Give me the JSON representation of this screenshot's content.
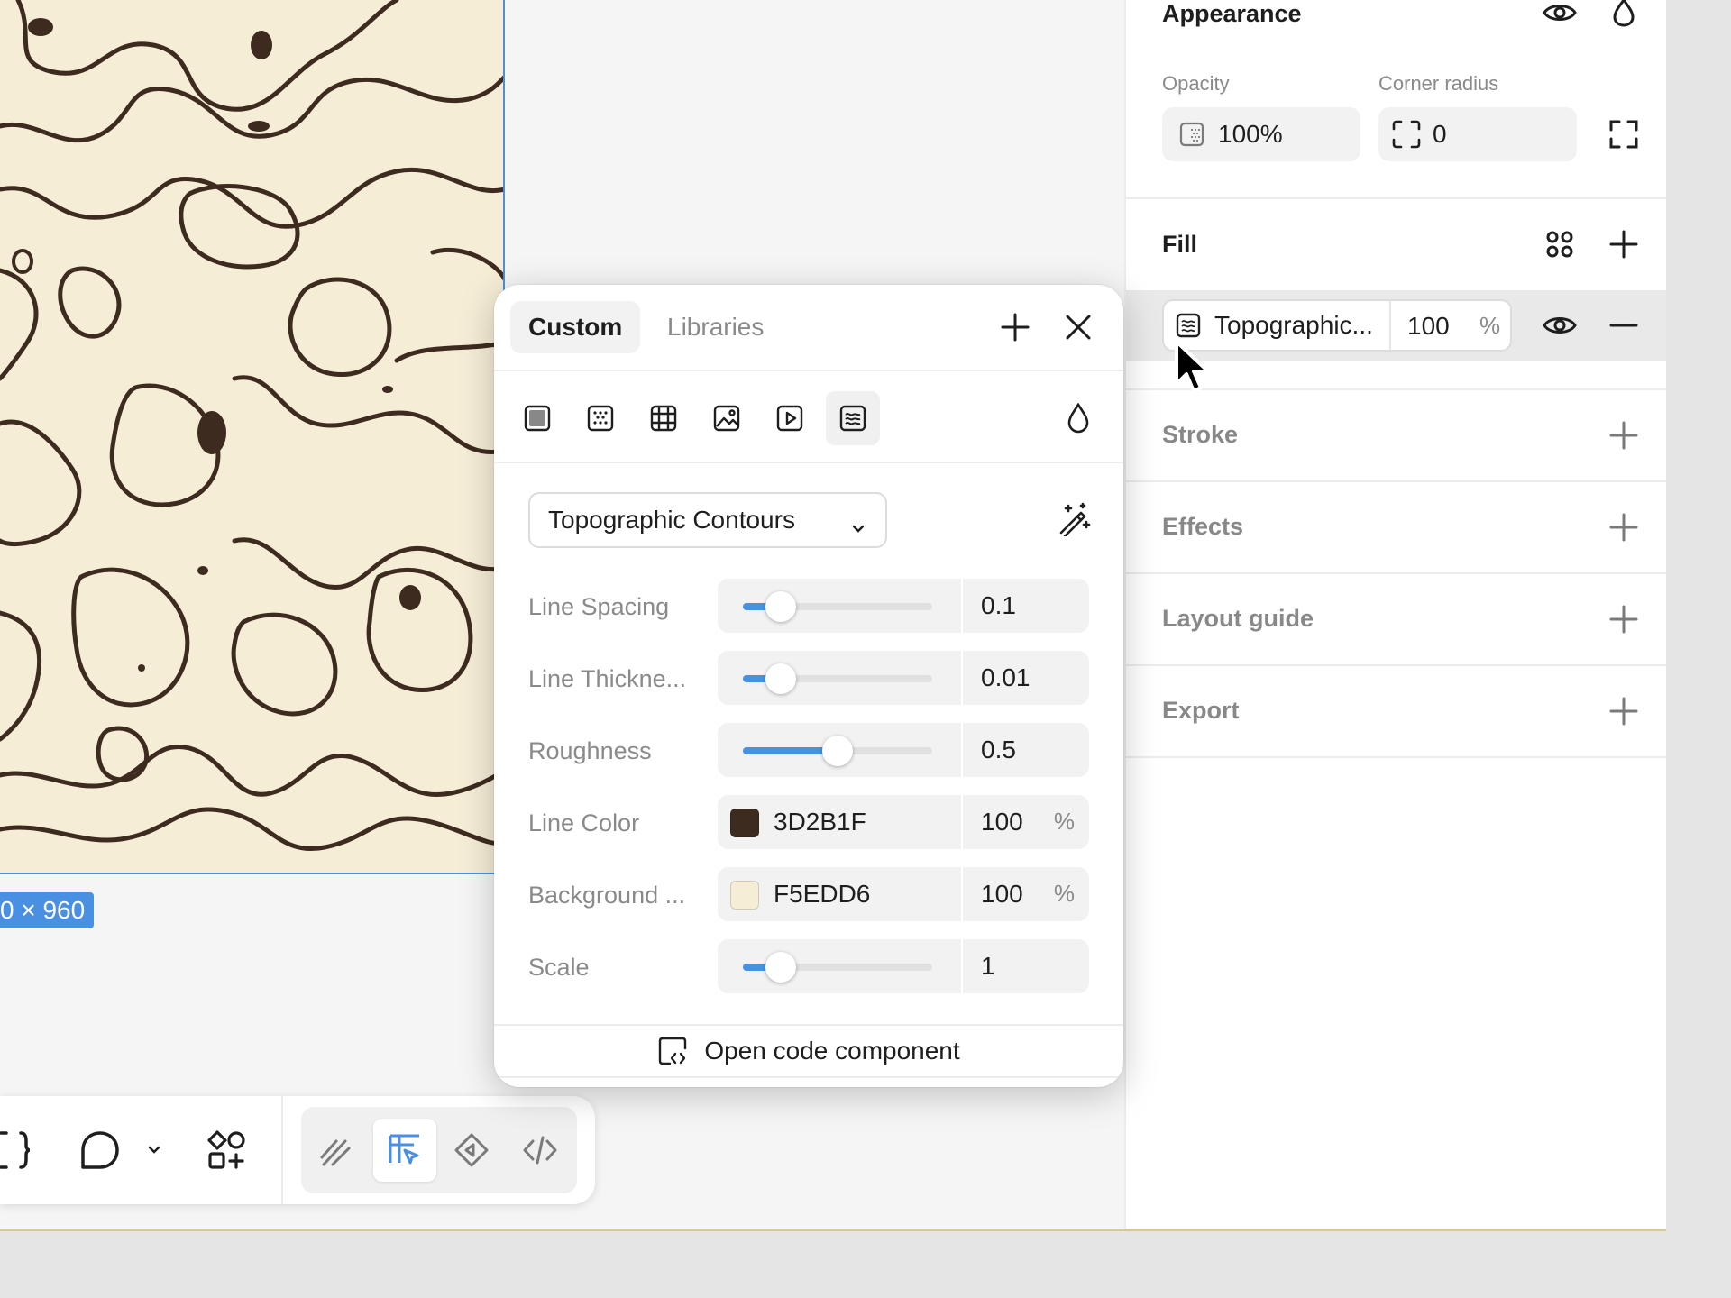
{
  "canvas": {
    "size_badge": "0 × 960"
  },
  "right_panel": {
    "appearance": {
      "title": "Appearance",
      "opacity_label": "Opacity",
      "opacity_value": "100%",
      "corner_radius_label": "Corner radius",
      "corner_radius_value": "0"
    },
    "fill": {
      "title": "Fill",
      "item_name": "Topographic...",
      "item_opacity": "100",
      "item_percent_sign": "%"
    },
    "stroke": {
      "title": "Stroke"
    },
    "effects": {
      "title": "Effects"
    },
    "layout_guide": {
      "title": "Layout guide"
    },
    "export": {
      "title": "Export"
    }
  },
  "popover": {
    "tabs": [
      "Custom",
      "Libraries"
    ],
    "active_tab": "Custom",
    "preset_dropdown": "Topographic Contours",
    "properties": [
      {
        "label": "Line Spacing",
        "value": "0.1",
        "slider_fraction": 0.2
      },
      {
        "label": "Line Thickne...",
        "value": "0.01",
        "slider_fraction": 0.2
      },
      {
        "label": "Roughness",
        "value": "0.5",
        "slider_fraction": 0.5
      },
      {
        "label": "Line Color",
        "hex": "3D2B1F",
        "opacity": "100",
        "percent_sign": "%",
        "swatch_color": "#3D2B1F"
      },
      {
        "label": "Background ...",
        "hex": "F5EDD6",
        "opacity": "100",
        "percent_sign": "%",
        "swatch_color": "#F5EDD6"
      },
      {
        "label": "Scale",
        "value": "1",
        "slider_fraction": 0.2
      }
    ],
    "footer_button": "Open code component"
  },
  "colors": {
    "accent": "#4a90e2",
    "contour_line": "#3D2B1F",
    "contour_background": "#F5EDD6"
  }
}
